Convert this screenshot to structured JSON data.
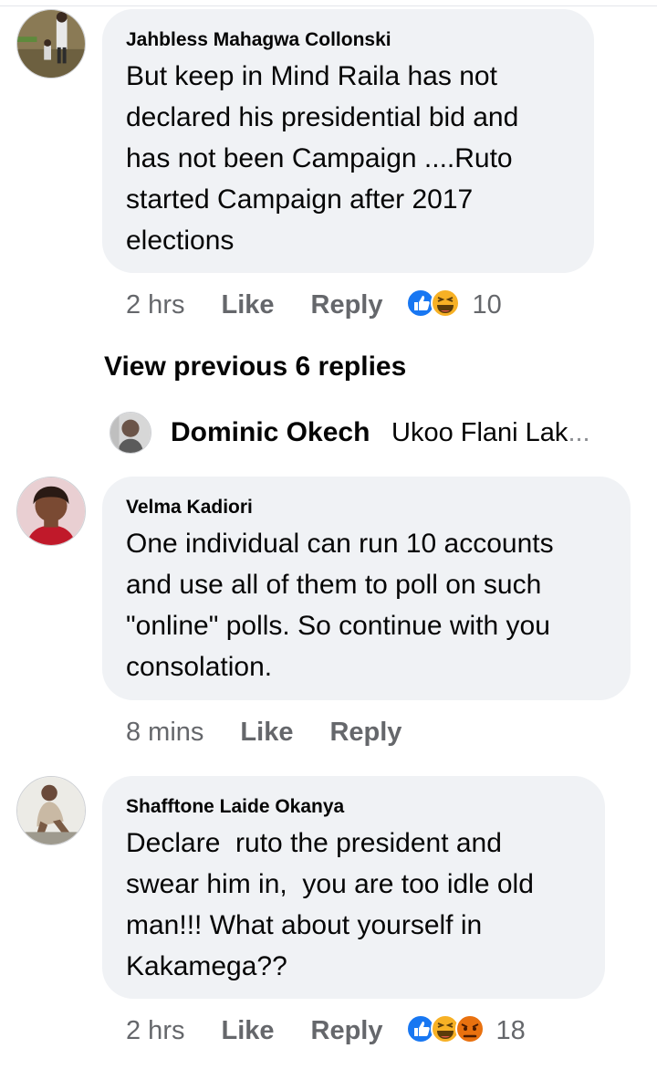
{
  "comments": [
    {
      "author": "Jahbless Mahagwa Collonski",
      "text": "But keep in Mind Raila has not\ndeclared his presidential bid and\nhas not been Campaign ....Ruto\nstarted Campaign after 2017\nelections",
      "time": "2 hrs",
      "like_label": "Like",
      "reply_label": "Reply",
      "reactions": [
        "like-icon",
        "haha-icon"
      ],
      "reaction_count": "10"
    },
    {
      "author": "Velma Kadiori",
      "text": "One individual can run 10 accounts\nand use all of them to poll on such\n\"online\" polls. So continue with you\nconsolation.",
      "time": "8 mins",
      "like_label": "Like",
      "reply_label": "Reply"
    },
    {
      "author": "Shafftone Laide Okanya",
      "text": "Declare  ruto the president and\nswear him in,  you are too idle old\nman!!! What about yourself in\nKakamega??",
      "time": "2 hrs",
      "like_label": "Like",
      "reply_label": "Reply",
      "reactions": [
        "like-icon",
        "haha-icon",
        "angry-icon"
      ],
      "reaction_count": "18"
    }
  ],
  "view_previous": "View previous 6 replies",
  "collapsed_reply": {
    "author": "Dominic Okech",
    "snippet": "Ukoo Flani Lak",
    "ellipsis": "..."
  },
  "colors": {
    "bubble": "#f0f2f5",
    "meta_text": "#65676b",
    "like_blue": "#1877f2",
    "haha_yellow": "#f7b125",
    "angry_orange": "#e9710f"
  }
}
